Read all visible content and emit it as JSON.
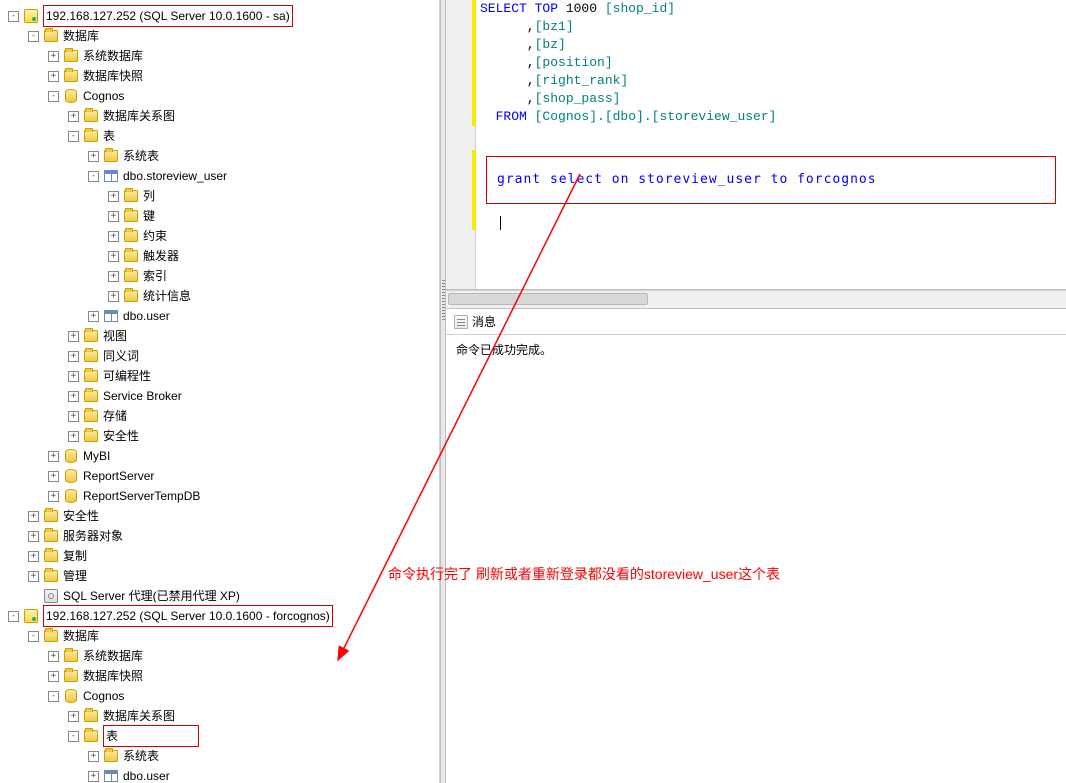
{
  "tree": [
    {
      "indent": 8,
      "toggle": "-",
      "icon": "server",
      "label": "192.168.127.252 (SQL Server 10.0.1600 - sa)",
      "boxed": true,
      "interact": true,
      "name": "server-node-sa"
    },
    {
      "indent": 28,
      "toggle": "-",
      "icon": "folder",
      "label": "数据库",
      "interact": true,
      "name": "databases-node"
    },
    {
      "indent": 48,
      "toggle": "+",
      "icon": "folder",
      "label": "系统数据库",
      "interact": true,
      "name": "sys-db-node"
    },
    {
      "indent": 48,
      "toggle": "+",
      "icon": "folder",
      "label": "数据库快照",
      "interact": true,
      "name": "db-snapshot-node"
    },
    {
      "indent": 48,
      "toggle": "-",
      "icon": "db",
      "label": "Cognos",
      "interact": true,
      "name": "db-cognos"
    },
    {
      "indent": 68,
      "toggle": "+",
      "icon": "folder",
      "label": "数据库关系图",
      "interact": true,
      "name": "db-diagram-node"
    },
    {
      "indent": 68,
      "toggle": "-",
      "icon": "folder",
      "label": "表",
      "interact": true,
      "name": "tables-node"
    },
    {
      "indent": 88,
      "toggle": "+",
      "icon": "folder",
      "label": "系统表",
      "interact": true,
      "name": "sys-tables-node"
    },
    {
      "indent": 88,
      "toggle": "-",
      "icon": "table",
      "label": "dbo.storeview_user",
      "interact": true,
      "name": "table-storeview-user"
    },
    {
      "indent": 108,
      "toggle": "+",
      "icon": "folder",
      "label": "列",
      "interact": true,
      "name": "columns-node"
    },
    {
      "indent": 108,
      "toggle": "+",
      "icon": "folder",
      "label": "键",
      "interact": true,
      "name": "keys-node"
    },
    {
      "indent": 108,
      "toggle": "+",
      "icon": "folder",
      "label": "约束",
      "interact": true,
      "name": "constraints-node"
    },
    {
      "indent": 108,
      "toggle": "+",
      "icon": "folder",
      "label": "触发器",
      "interact": true,
      "name": "triggers-node"
    },
    {
      "indent": 108,
      "toggle": "+",
      "icon": "folder",
      "label": "索引",
      "interact": true,
      "name": "indexes-node"
    },
    {
      "indent": 108,
      "toggle": "+",
      "icon": "folder",
      "label": "统计信息",
      "interact": true,
      "name": "statistics-node"
    },
    {
      "indent": 88,
      "toggle": "+",
      "icon": "table",
      "label": "dbo.user",
      "interact": true,
      "name": "table-user"
    },
    {
      "indent": 68,
      "toggle": "+",
      "icon": "folder",
      "label": "视图",
      "interact": true,
      "name": "views-node"
    },
    {
      "indent": 68,
      "toggle": "+",
      "icon": "folder",
      "label": "同义词",
      "interact": true,
      "name": "synonyms-node"
    },
    {
      "indent": 68,
      "toggle": "+",
      "icon": "folder",
      "label": "可编程性",
      "interact": true,
      "name": "programmability-node"
    },
    {
      "indent": 68,
      "toggle": "+",
      "icon": "folder",
      "label": "Service Broker",
      "interact": true,
      "name": "service-broker-node"
    },
    {
      "indent": 68,
      "toggle": "+",
      "icon": "folder",
      "label": "存储",
      "interact": true,
      "name": "storage-node"
    },
    {
      "indent": 68,
      "toggle": "+",
      "icon": "folder",
      "label": "安全性",
      "interact": true,
      "name": "db-security-node"
    },
    {
      "indent": 48,
      "toggle": "+",
      "icon": "db",
      "label": "MyBI",
      "interact": true,
      "name": "db-mybi"
    },
    {
      "indent": 48,
      "toggle": "+",
      "icon": "db",
      "label": "ReportServer",
      "interact": true,
      "name": "db-reportserver"
    },
    {
      "indent": 48,
      "toggle": "+",
      "icon": "db",
      "label": "ReportServerTempDB",
      "interact": true,
      "name": "db-reportservertempdb"
    },
    {
      "indent": 28,
      "toggle": "+",
      "icon": "folder",
      "label": "安全性",
      "interact": true,
      "name": "security-node"
    },
    {
      "indent": 28,
      "toggle": "+",
      "icon": "folder",
      "label": "服务器对象",
      "interact": true,
      "name": "server-objects-node"
    },
    {
      "indent": 28,
      "toggle": "+",
      "icon": "folder",
      "label": "复制",
      "interact": true,
      "name": "replication-node"
    },
    {
      "indent": 28,
      "toggle": "+",
      "icon": "folder",
      "label": "管理",
      "interact": true,
      "name": "management-node"
    },
    {
      "indent": 28,
      "toggle": " ",
      "icon": "agent",
      "label": "SQL Server 代理(已禁用代理 XP)",
      "interact": true,
      "name": "sql-agent-node"
    },
    {
      "indent": 8,
      "toggle": "-",
      "icon": "server",
      "label": "192.168.127.252 (SQL Server 10.0.1600 - forcognos)",
      "boxed": true,
      "interact": true,
      "name": "server-node-forcognos"
    },
    {
      "indent": 28,
      "toggle": "-",
      "icon": "folder",
      "label": "数据库",
      "interact": true,
      "name": "databases2-node"
    },
    {
      "indent": 48,
      "toggle": "+",
      "icon": "folder",
      "label": "系统数据库",
      "interact": true,
      "name": "sys-db2-node"
    },
    {
      "indent": 48,
      "toggle": "+",
      "icon": "folder",
      "label": "数据库快照",
      "interact": true,
      "name": "db-snapshot2-node"
    },
    {
      "indent": 48,
      "toggle": "-",
      "icon": "db",
      "label": "Cognos",
      "interact": true,
      "name": "db-cognos2"
    },
    {
      "indent": 68,
      "toggle": "+",
      "icon": "folder",
      "label": "数据库关系图",
      "interact": true,
      "name": "db-diagram2-node"
    },
    {
      "indent": 68,
      "toggle": "-",
      "icon": "folder",
      "label": "表",
      "boxed": true,
      "boxWide": true,
      "interact": true,
      "name": "tables2-node"
    },
    {
      "indent": 88,
      "toggle": "+",
      "icon": "folder",
      "label": "系统表",
      "interact": true,
      "name": "sys-tables2-node"
    },
    {
      "indent": 88,
      "toggle": "+",
      "icon": "table",
      "label": "dbo.user",
      "interact": true,
      "name": "table-user2"
    }
  ],
  "sql": {
    "lines": [
      {
        "segs": [
          {
            "t": "SELECT TOP ",
            "c": "kw"
          },
          {
            "t": "1000 ",
            "c": "num"
          },
          {
            "t": "[shop_id]",
            "c": "brk"
          }
        ]
      },
      {
        "segs": [
          {
            "t": "      ,",
            "c": ""
          },
          {
            "t": "[bz1]",
            "c": "brk"
          }
        ]
      },
      {
        "segs": [
          {
            "t": "      ,",
            "c": ""
          },
          {
            "t": "[bz]",
            "c": "brk"
          }
        ]
      },
      {
        "segs": [
          {
            "t": "      ,",
            "c": ""
          },
          {
            "t": "[position]",
            "c": "brk"
          }
        ]
      },
      {
        "segs": [
          {
            "t": "      ,",
            "c": ""
          },
          {
            "t": "[right_rank]",
            "c": "brk"
          }
        ]
      },
      {
        "segs": [
          {
            "t": "      ,",
            "c": ""
          },
          {
            "t": "[shop_pass]",
            "c": "brk"
          }
        ]
      },
      {
        "segs": [
          {
            "t": "  FROM ",
            "c": "kw"
          },
          {
            "t": "[Cognos].[dbo].[storeview_user]",
            "c": "brk"
          }
        ]
      }
    ],
    "grant": "grant select on storeview_user to forcognos"
  },
  "messages": {
    "tab": "消息",
    "body": "命令已成功完成。"
  },
  "annotation": "命令执行完了 刷新或者重新登录都没看的storeview_user这个表"
}
